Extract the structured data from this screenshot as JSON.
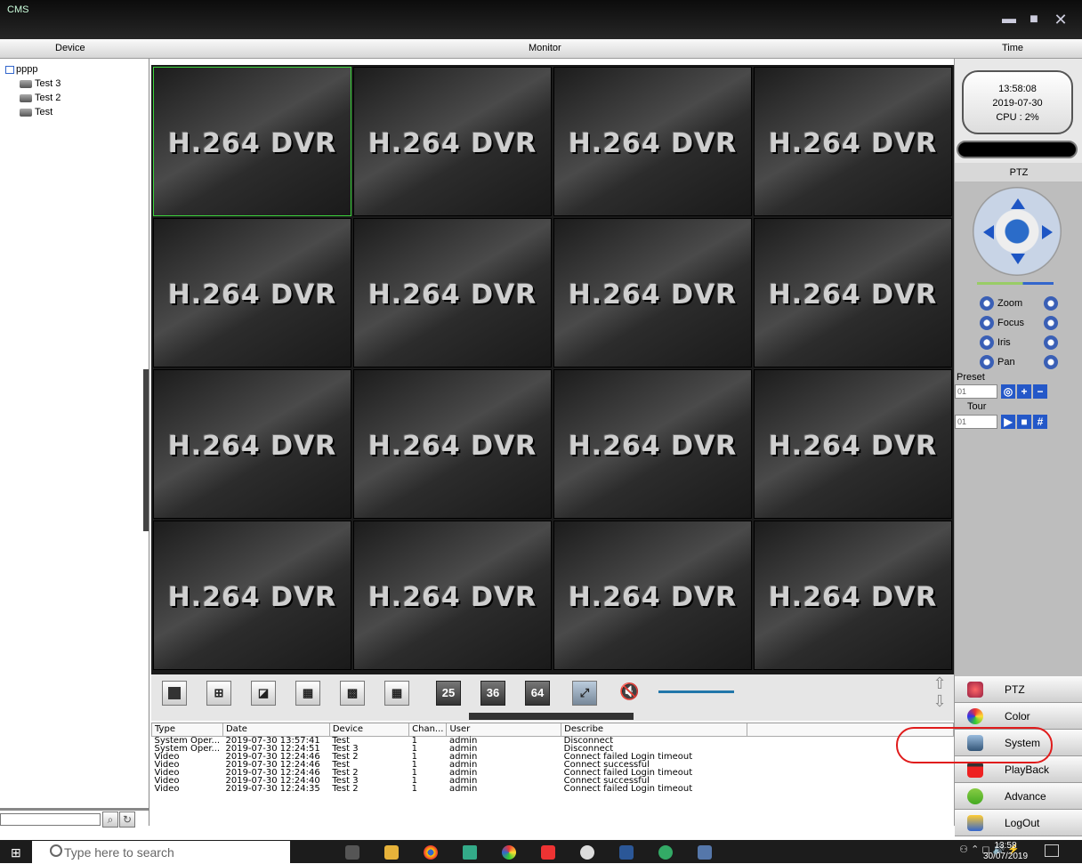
{
  "window": {
    "title": "CMS",
    "controls": [
      "minimize-icon",
      "maximize-icon",
      "close-icon"
    ]
  },
  "header": {
    "device": "Device",
    "monitor": "Monitor",
    "time": "Time"
  },
  "tree": {
    "root": "pppp",
    "devices": [
      "Test 3",
      "Test 2",
      "Test"
    ]
  },
  "monitor": {
    "tile_label": "H.264 DVR",
    "grid": "4x4",
    "selected_tile": 1
  },
  "splitbar": {
    "layouts": [
      "1",
      "4",
      "6",
      "8",
      "9",
      "16",
      "25",
      "36",
      "64"
    ],
    "fullscreen_icon": "fullscreen-icon",
    "mute_icon": "mute-icon"
  },
  "log": {
    "columns": [
      "Type",
      "Date",
      "Device",
      "Chan...",
      "User",
      "Describe"
    ],
    "rows": [
      [
        "System Oper...",
        "2019-07-30 13:57:41",
        "Test",
        "1",
        "admin",
        "Disconnect"
      ],
      [
        "System Oper...",
        "2019-07-30 12:24:51",
        "Test 3",
        "1",
        "admin",
        "Disconnect"
      ],
      [
        "Video",
        "2019-07-30 12:24:46",
        "Test 2",
        "1",
        "admin",
        "Connect failed Login timeout"
      ],
      [
        "Video",
        "2019-07-30 12:24:46",
        "Test",
        "1",
        "admin",
        "Connect successful"
      ],
      [
        "Video",
        "2019-07-30 12:24:46",
        "Test 2",
        "1",
        "admin",
        "Connect failed Login timeout"
      ],
      [
        "Video",
        "2019-07-30 12:24:40",
        "Test 3",
        "1",
        "admin",
        "Connect successful"
      ],
      [
        "Video",
        "2019-07-30 12:24:35",
        "Test 2",
        "1",
        "admin",
        "Connect failed Login timeout"
      ]
    ]
  },
  "status": {
    "time": "13:58:08",
    "date": "2019-07-30",
    "cpu": "CPU : 2%"
  },
  "ptz": {
    "title": "PTZ",
    "controls": [
      "Zoom",
      "Focus",
      "Iris",
      "Pan"
    ],
    "preset_label": "Preset",
    "preset_value": "01",
    "tour_label": "Tour",
    "tour_value": "01"
  },
  "menu": [
    "PTZ",
    "Color",
    "System",
    "PlayBack",
    "Advance",
    "LogOut"
  ],
  "taskbar": {
    "search_placeholder": "Type here to search",
    "time": "13:58",
    "date": "30/07/2019"
  },
  "colors": {
    "selected_tile_border": "#3cd63c",
    "annotation": "#e01c1c",
    "ptz_blue": "#2458c8"
  }
}
